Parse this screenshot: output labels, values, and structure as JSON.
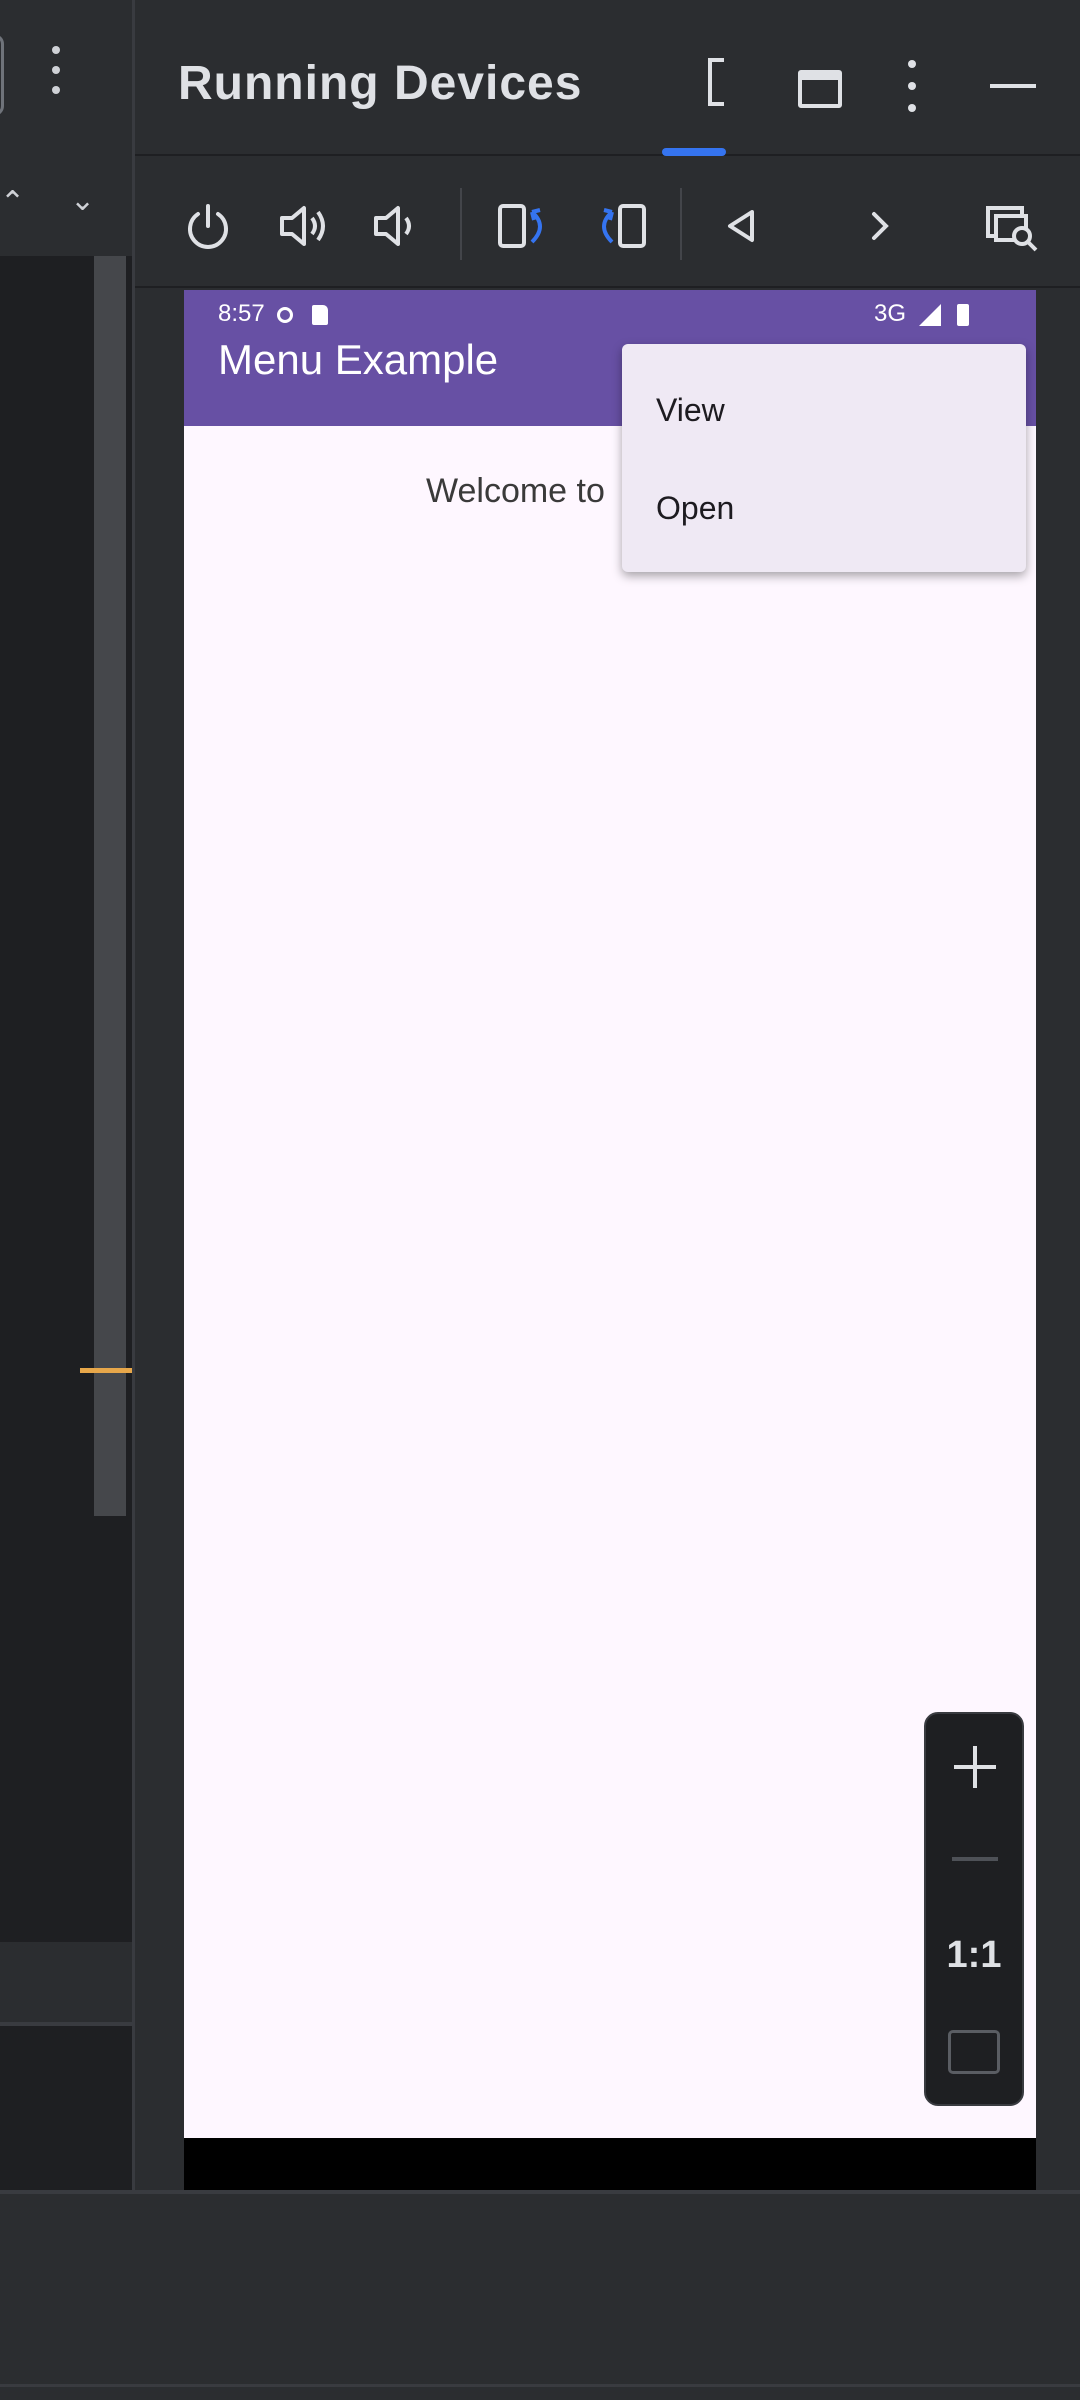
{
  "panel": {
    "title": "Running Devices",
    "icons": [
      "device-tab-icon",
      "window-layout-icon",
      "more-vertical-icon",
      "minimize-icon"
    ]
  },
  "toolbar": {
    "buttons": [
      "power-icon",
      "volume-up-icon",
      "volume-down-icon",
      "rotate-left-icon",
      "rotate-right-icon",
      "back-icon",
      "forward-icon",
      "device-inspector-icon"
    ]
  },
  "device": {
    "status_time": "8:57",
    "status_network": "3G",
    "app_title": "Menu Example",
    "welcome_text": "Welcome to",
    "accent_color": "#6750a4",
    "menu_items": [
      "View",
      "Open"
    ]
  },
  "zoom": {
    "actual_size_label": "1:1"
  },
  "colors": {
    "ide_background": "#2b2d30",
    "tab_indicator": "#3574f0",
    "scroll_marker": "#e7a74a"
  }
}
